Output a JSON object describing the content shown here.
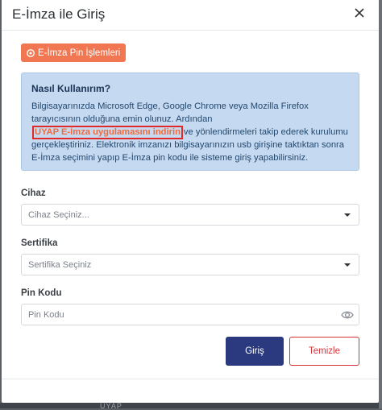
{
  "modal": {
    "title": "E-İmza ile Giriş"
  },
  "pin_button": {
    "label": "E-İmza Pin İşlemleri"
  },
  "info": {
    "title": "Nasıl Kullanırım?",
    "text_before": "Bilgisayarınızda Microsoft Edge, Google Chrome veya Mozilla Firefox tarayıcısının olduğuna emin olunuz. Ardından",
    "link": "UYAP E-İmza uygulamasını indirin",
    "text_after": "ve yönlendirmeleri takip ederek kurulumu gerçekleştiriniz. Elektronik imzanızı bilgisayarınızın usb girişine taktıktan sonra E-İmza seçimini yapıp E-İmza pin kodu ile sisteme giriş yapabilirsiniz."
  },
  "fields": {
    "device": {
      "label": "Cihaz",
      "placeholder": "Cihaz Seçiniz..."
    },
    "certificate": {
      "label": "Sertifika",
      "placeholder": "Sertifika Seçiniz"
    },
    "pin": {
      "label": "Pin Kodu",
      "placeholder": "Pin Kodu"
    }
  },
  "actions": {
    "login": "Giriş",
    "clear": "Temizle"
  },
  "background": {
    "text": "UYAP"
  },
  "colors": {
    "pin_button": "#f07752",
    "info_bg": "#c5daf0",
    "primary": "#2b3a7e",
    "danger": "#d9333a",
    "link": "#f26a3c"
  }
}
